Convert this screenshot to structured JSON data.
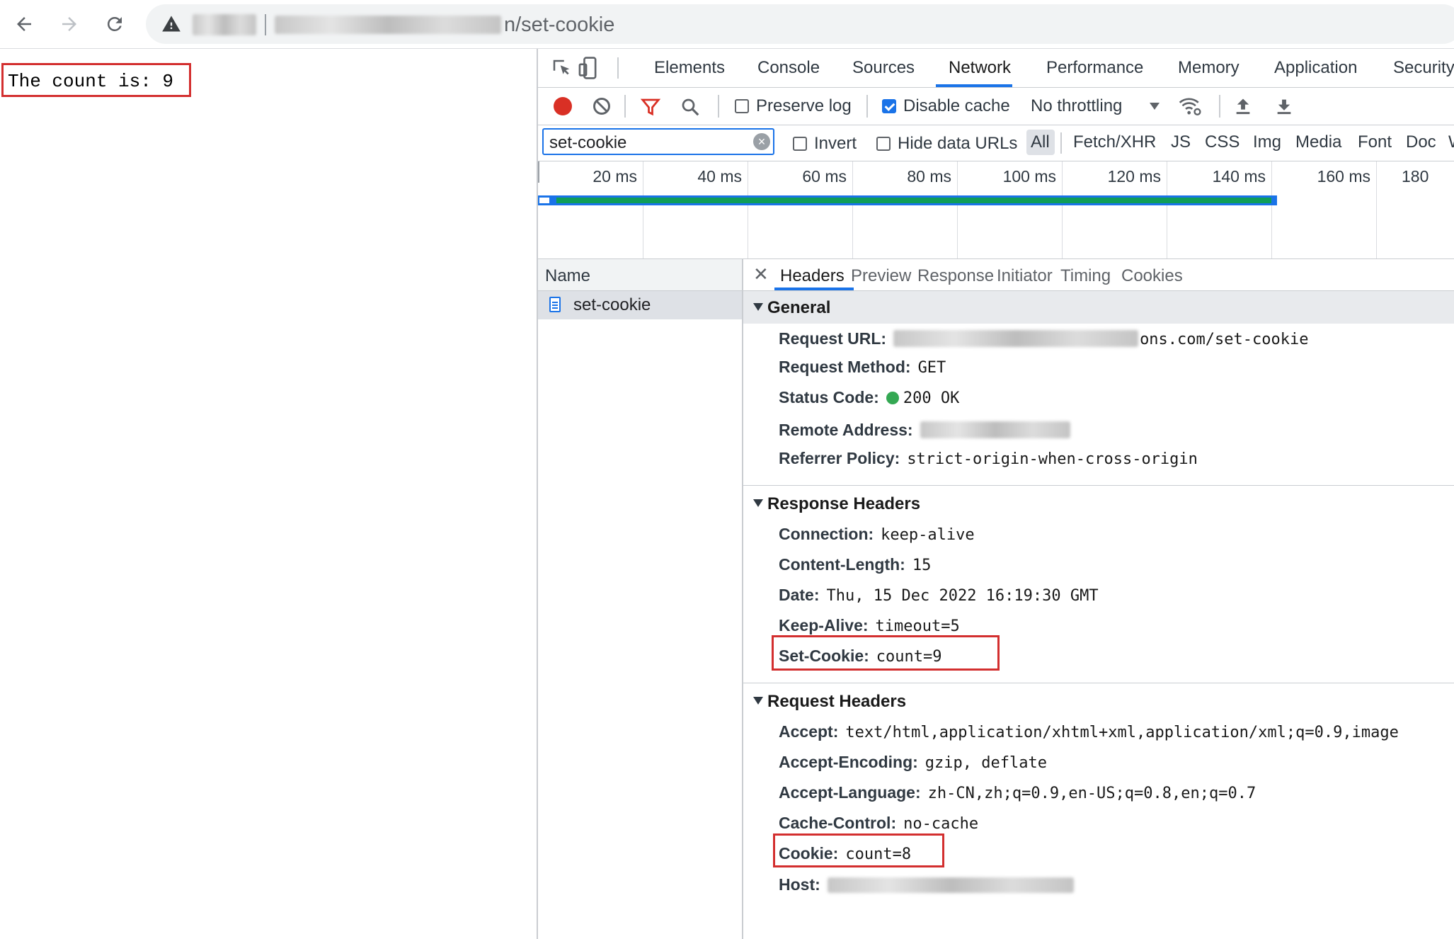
{
  "address_bar": {
    "url_suffix": "n/set-cookie"
  },
  "page": {
    "count_text": "The count is: 9"
  },
  "devtools": {
    "tabs": [
      "Elements",
      "Console",
      "Sources",
      "Network",
      "Performance",
      "Memory",
      "Application",
      "Security"
    ],
    "active_tab": "Network",
    "toolbar": {
      "preserve_log": "Preserve log",
      "preserve_log_checked": false,
      "disable_cache": "Disable cache",
      "disable_cache_checked": true,
      "throttling": "No throttling"
    },
    "filter": {
      "value": "set-cookie",
      "invert": "Invert",
      "hide_data_urls": "Hide data URLs",
      "types": [
        "All",
        "Fetch/XHR",
        "JS",
        "CSS",
        "Img",
        "Media",
        "Font",
        "Doc",
        "W"
      ],
      "active_type": "All"
    },
    "timeline": {
      "ticks": [
        "20 ms",
        "40 ms",
        "60 ms",
        "80 ms",
        "100 ms",
        "120 ms",
        "140 ms",
        "160 ms",
        "180"
      ]
    },
    "requests": {
      "column_header": "Name",
      "rows": [
        {
          "name": "set-cookie"
        }
      ]
    },
    "detail": {
      "tabs": [
        "Headers",
        "Preview",
        "Response",
        "Initiator",
        "Timing",
        "Cookies"
      ],
      "active_tab": "Headers",
      "general": {
        "title": "General",
        "items": [
          {
            "key": "Request URL:",
            "value": "ons.com/set-cookie"
          },
          {
            "key": "Request Method:",
            "value": "GET"
          },
          {
            "key": "Status Code:",
            "value": "200 OK"
          },
          {
            "key": "Remote Address:",
            "value": ""
          },
          {
            "key": "Referrer Policy:",
            "value": "strict-origin-when-cross-origin"
          }
        ]
      },
      "response_headers": {
        "title": "Response Headers",
        "items": [
          {
            "key": "Connection:",
            "value": "keep-alive"
          },
          {
            "key": "Content-Length:",
            "value": "15"
          },
          {
            "key": "Date:",
            "value": "Thu, 15 Dec 2022 16:19:30 GMT"
          },
          {
            "key": "Keep-Alive:",
            "value": "timeout=5"
          },
          {
            "key": "Set-Cookie:",
            "value": "count=9"
          }
        ]
      },
      "request_headers": {
        "title": "Request Headers",
        "items": [
          {
            "key": "Accept:",
            "value": "text/html,application/xhtml+xml,application/xml;q=0.9,image"
          },
          {
            "key": "Accept-Encoding:",
            "value": "gzip, deflate"
          },
          {
            "key": "Accept-Language:",
            "value": "zh-CN,zh;q=0.9,en-US;q=0.8,en;q=0.7"
          },
          {
            "key": "Cache-Control:",
            "value": "no-cache"
          },
          {
            "key": "Cookie:",
            "value": "count=8"
          },
          {
            "key": "Host:",
            "value": ""
          }
        ]
      }
    }
  },
  "colors": {
    "accent": "#1a73e8",
    "highlight_box": "#d32f2f",
    "status_ok": "#34a853",
    "record": "#d93025"
  }
}
